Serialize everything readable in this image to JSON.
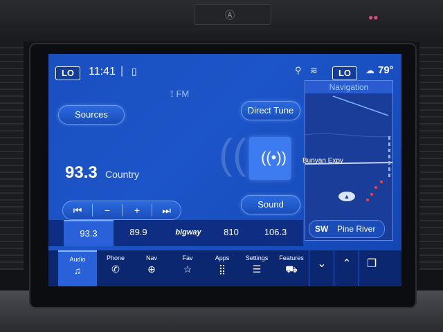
{
  "status_bar": {
    "lo_left": "LO",
    "time": "11:41",
    "separator": "|",
    "lo_right": "LO",
    "temperature": "79°"
  },
  "radio": {
    "band": "FM",
    "sources_label": "Sources",
    "direct_tune_label": "Direct Tune",
    "sound_label": "Sound",
    "frequency": "93.3",
    "genre": "Country"
  },
  "presets": [
    {
      "label": "93.3",
      "selected": true
    },
    {
      "label": "89.9",
      "selected": false
    },
    {
      "label": "bigway",
      "selected": false
    },
    {
      "label": "810",
      "selected": false
    },
    {
      "label": "106.3",
      "selected": false
    }
  ],
  "navigation": {
    "title": "Navigation",
    "road_label": "Bunyan Expy",
    "direction": "SW",
    "street": "Pine River"
  },
  "bottom_nav": [
    {
      "label": "Audio",
      "icon": "music-note-icon",
      "active": true
    },
    {
      "label": "Phone",
      "icon": "phone-icon",
      "active": false
    },
    {
      "label": "Nav",
      "icon": "compass-icon",
      "active": false
    },
    {
      "label": "Fav",
      "icon": "star-icon",
      "active": false
    },
    {
      "label": "Apps",
      "icon": "grid-icon",
      "active": false
    },
    {
      "label": "Settings",
      "icon": "sliders-icon",
      "active": false
    },
    {
      "label": "Features",
      "icon": "car-icon",
      "active": false
    }
  ],
  "colors": {
    "screen_bg": "#1c55c8",
    "accent": "#2a61d8",
    "nav_title": "#9fd0ff"
  }
}
